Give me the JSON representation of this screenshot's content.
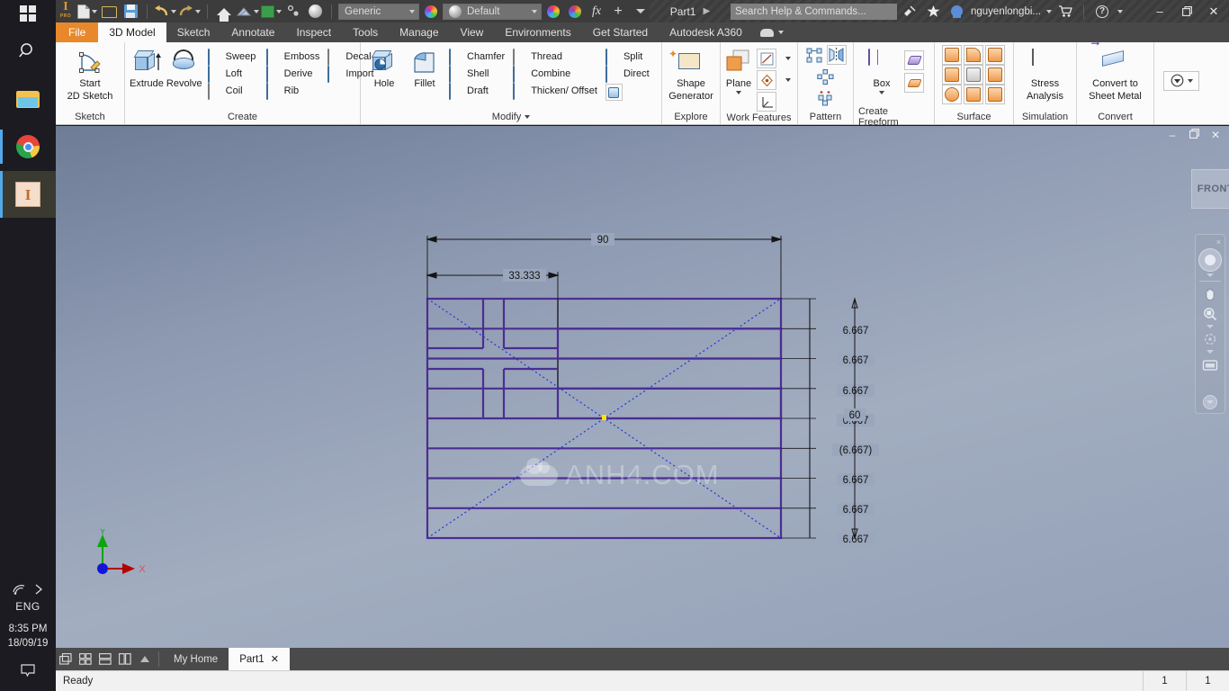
{
  "os_taskbar": {
    "start": "start-button",
    "items": [
      {
        "name": "search-icon",
        "label": "Search"
      },
      {
        "name": "file-explorer-icon",
        "label": "File Explorer"
      },
      {
        "name": "google-chrome-icon",
        "label": "Google Chrome"
      },
      {
        "name": "autodesk-inventor-icon",
        "label": "Autodesk Inventor Professional"
      }
    ],
    "tray": {
      "network_icon": "wifi-icon",
      "overflow_icon": "chevron-right-icon",
      "language": "ENG",
      "time": "8:35 PM",
      "date": "18/09/19",
      "notification_icon": "notification-icon"
    }
  },
  "titlebar": {
    "app_logo": "I",
    "app_logo_sub": "PRO",
    "quick_access": [
      {
        "name": "new-document-button",
        "icon": "new-document-icon"
      },
      {
        "name": "open-button",
        "icon": "open-folder-icon"
      },
      {
        "name": "save-button",
        "icon": "save-icon"
      },
      {
        "name": "undo-button",
        "icon": "undo-arrow-icon"
      },
      {
        "name": "redo-button",
        "icon": "redo-arrow-icon"
      },
      {
        "name": "home-button",
        "icon": "home-icon"
      },
      {
        "name": "return-button",
        "icon": "return-icon"
      },
      {
        "name": "project-button",
        "icon": "green-box-icon"
      },
      {
        "name": "select-button",
        "icon": "select-icon"
      },
      {
        "name": "appearance-button",
        "icon": "sphere-icon"
      }
    ],
    "material_combo": "Generic",
    "appearance_combo": "Default",
    "fx_label": "fx",
    "document_title": "Part1",
    "search_placeholder": "Search Help & Commands...",
    "sign_in_user": "nguyenlongbi...",
    "icons": {
      "satellite": "satellite-icon",
      "star": "star-icon",
      "cart": "shopping-cart-icon",
      "help": "help-icon"
    },
    "window_controls": {
      "minimize": "–",
      "restore": "❐",
      "close": "✕"
    }
  },
  "ribbon": {
    "tabs": [
      {
        "label": "File",
        "state": "file"
      },
      {
        "label": "3D Model",
        "state": "active"
      },
      {
        "label": "Sketch",
        "state": "normal"
      },
      {
        "label": "Annotate",
        "state": "normal"
      },
      {
        "label": "Inspect",
        "state": "normal"
      },
      {
        "label": "Tools",
        "state": "normal"
      },
      {
        "label": "Manage",
        "state": "normal"
      },
      {
        "label": "View",
        "state": "normal"
      },
      {
        "label": "Environments",
        "state": "normal"
      },
      {
        "label": "Get Started",
        "state": "normal"
      },
      {
        "label": "Autodesk A360",
        "state": "normal"
      }
    ],
    "panels": [
      {
        "title": "Sketch",
        "big": [
          {
            "label_line1": "Start",
            "label_line2": "2D Sketch",
            "icon": "start-2d-sketch-icon",
            "dropdown": true
          }
        ],
        "small": []
      },
      {
        "title": "Create",
        "big": [
          {
            "label_line1": "Extrude",
            "label_line2": "",
            "icon": "extrude-icon"
          },
          {
            "label_line1": "Revolve",
            "label_line2": "",
            "icon": "revolve-icon"
          }
        ],
        "small_col1": [
          {
            "label": "Sweep",
            "icon": "sweep-icon"
          },
          {
            "label": "Loft",
            "icon": "loft-icon"
          },
          {
            "label": "Coil",
            "icon": "coil-icon"
          }
        ],
        "small_col2": [
          {
            "label": "Emboss",
            "icon": "emboss-icon"
          },
          {
            "label": "Derive",
            "icon": "derive-icon"
          },
          {
            "label": "Rib",
            "icon": "rib-icon"
          }
        ],
        "small_col3": [
          {
            "label": "Decal",
            "icon": "decal-icon"
          },
          {
            "label": "Import",
            "icon": "import-icon"
          }
        ]
      },
      {
        "title": "Modify",
        "dropdown": true,
        "big": [
          {
            "label_line1": "Hole",
            "label_line2": "",
            "icon": "hole-icon"
          },
          {
            "label_line1": "Fillet",
            "label_line2": "",
            "icon": "fillet-icon"
          }
        ],
        "small_col1": [
          {
            "label": "Chamfer",
            "icon": "chamfer-icon"
          },
          {
            "label": "Shell",
            "icon": "shell-icon"
          },
          {
            "label": "Draft",
            "icon": "draft-icon"
          }
        ],
        "small_col2": [
          {
            "label": "Thread",
            "icon": "thread-icon"
          },
          {
            "label": "Combine",
            "icon": "combine-icon"
          },
          {
            "label": "Thicken/ Offset",
            "icon": "thicken-offset-icon"
          }
        ],
        "small_col3": [
          {
            "label": "Split",
            "icon": "split-icon"
          },
          {
            "label": "Direct",
            "icon": "direct-icon"
          },
          {
            "label": "",
            "icon": "delete-face-icon"
          }
        ]
      },
      {
        "title": "Explore",
        "big": [
          {
            "label_line1": "Shape",
            "label_line2": "Generator",
            "icon": "shape-generator-icon"
          }
        ]
      },
      {
        "title": "Work Features",
        "big": [
          {
            "label_line1": "Plane",
            "label_line2": "",
            "icon": "plane-icon",
            "dropdown": true
          }
        ],
        "grid": [
          {
            "icon": "work-axis-icon",
            "dropdown": true
          },
          {
            "icon": "work-point-icon",
            "dropdown": true
          },
          {
            "icon": "ucs-icon",
            "dropdown": false
          }
        ]
      },
      {
        "title": "Pattern",
        "grid": [
          {
            "icon": "rectangular-pattern-icon"
          },
          {
            "icon": "mirror-icon"
          },
          {
            "icon": "circular-pattern-icon"
          },
          {
            "icon": "sketch-driven-pattern-icon"
          }
        ]
      },
      {
        "title": "Create Freeform",
        "big": [
          {
            "label_line1": "Box",
            "label_line2": "",
            "icon": "freeform-box-icon",
            "dropdown": true
          }
        ],
        "grid": [
          {
            "icon": "freeform-plane-icon"
          },
          {
            "icon": "freeform-convert-icon"
          }
        ]
      },
      {
        "title": "Surface",
        "grid": [
          {
            "icon": "ruled-surface-icon"
          },
          {
            "icon": "patch-icon"
          },
          {
            "icon": "stitch-icon"
          },
          {
            "icon": "sculpt-icon"
          },
          {
            "icon": "trim-icon"
          },
          {
            "icon": "extend-icon"
          },
          {
            "icon": "boundary-patch-icon"
          },
          {
            "icon": "thicken-surface-icon"
          },
          {
            "icon": "replace-face-icon"
          }
        ]
      },
      {
        "title": "Simulation",
        "big": [
          {
            "label_line1": "Stress",
            "label_line2": "Analysis",
            "icon": "stress-analysis-icon"
          }
        ]
      },
      {
        "title": "Convert",
        "big": [
          {
            "label_line1": "Convert to",
            "label_line2": "Sheet Metal",
            "icon": "convert-sheet-metal-icon"
          }
        ]
      }
    ],
    "appearance_dropdown": "appearance-dropdown-button"
  },
  "viewport": {
    "watermark": "ANH4.COM",
    "view_cube_label": "FRONT",
    "navbar": {
      "close": "×",
      "wheel": "steering-wheel-icon",
      "pan": "pan-hand-icon",
      "zoom": "zoom-icon",
      "orbit": "orbit-icon",
      "look": "look-at-icon"
    },
    "axis": {
      "x_label": "X",
      "y_label": "Y"
    },
    "doc_window_controls": {
      "minimize": "–",
      "restore": "❐",
      "close": "✕"
    }
  },
  "sketch": {
    "name": "greek-flag-sketch",
    "dimensions": {
      "width_overall": "90",
      "canton_width": "33.333",
      "height_overall": "60",
      "stripes": [
        "6.667",
        "6.667",
        "6.667",
        "6.667",
        "(6.667)",
        "6.667",
        "6.667",
        "6.667"
      ]
    },
    "colors": {
      "sketch_line": "#4b2e91",
      "construction_line": "#2233dd",
      "dimension": "#141414",
      "point_highlight": "#ffe400"
    }
  },
  "docbar": {
    "dock_icons": [
      "tile-icon",
      "grid-icon",
      "horizontal-icon",
      "vertical-icon",
      "up-arrow-icon"
    ],
    "tabs": [
      {
        "label": "My Home",
        "active": false,
        "closable": false
      },
      {
        "label": "Part1",
        "active": true,
        "closable": true,
        "close": "✕"
      }
    ]
  },
  "statusbar": {
    "message": "Ready",
    "cell1": "1",
    "cell2": "1"
  }
}
